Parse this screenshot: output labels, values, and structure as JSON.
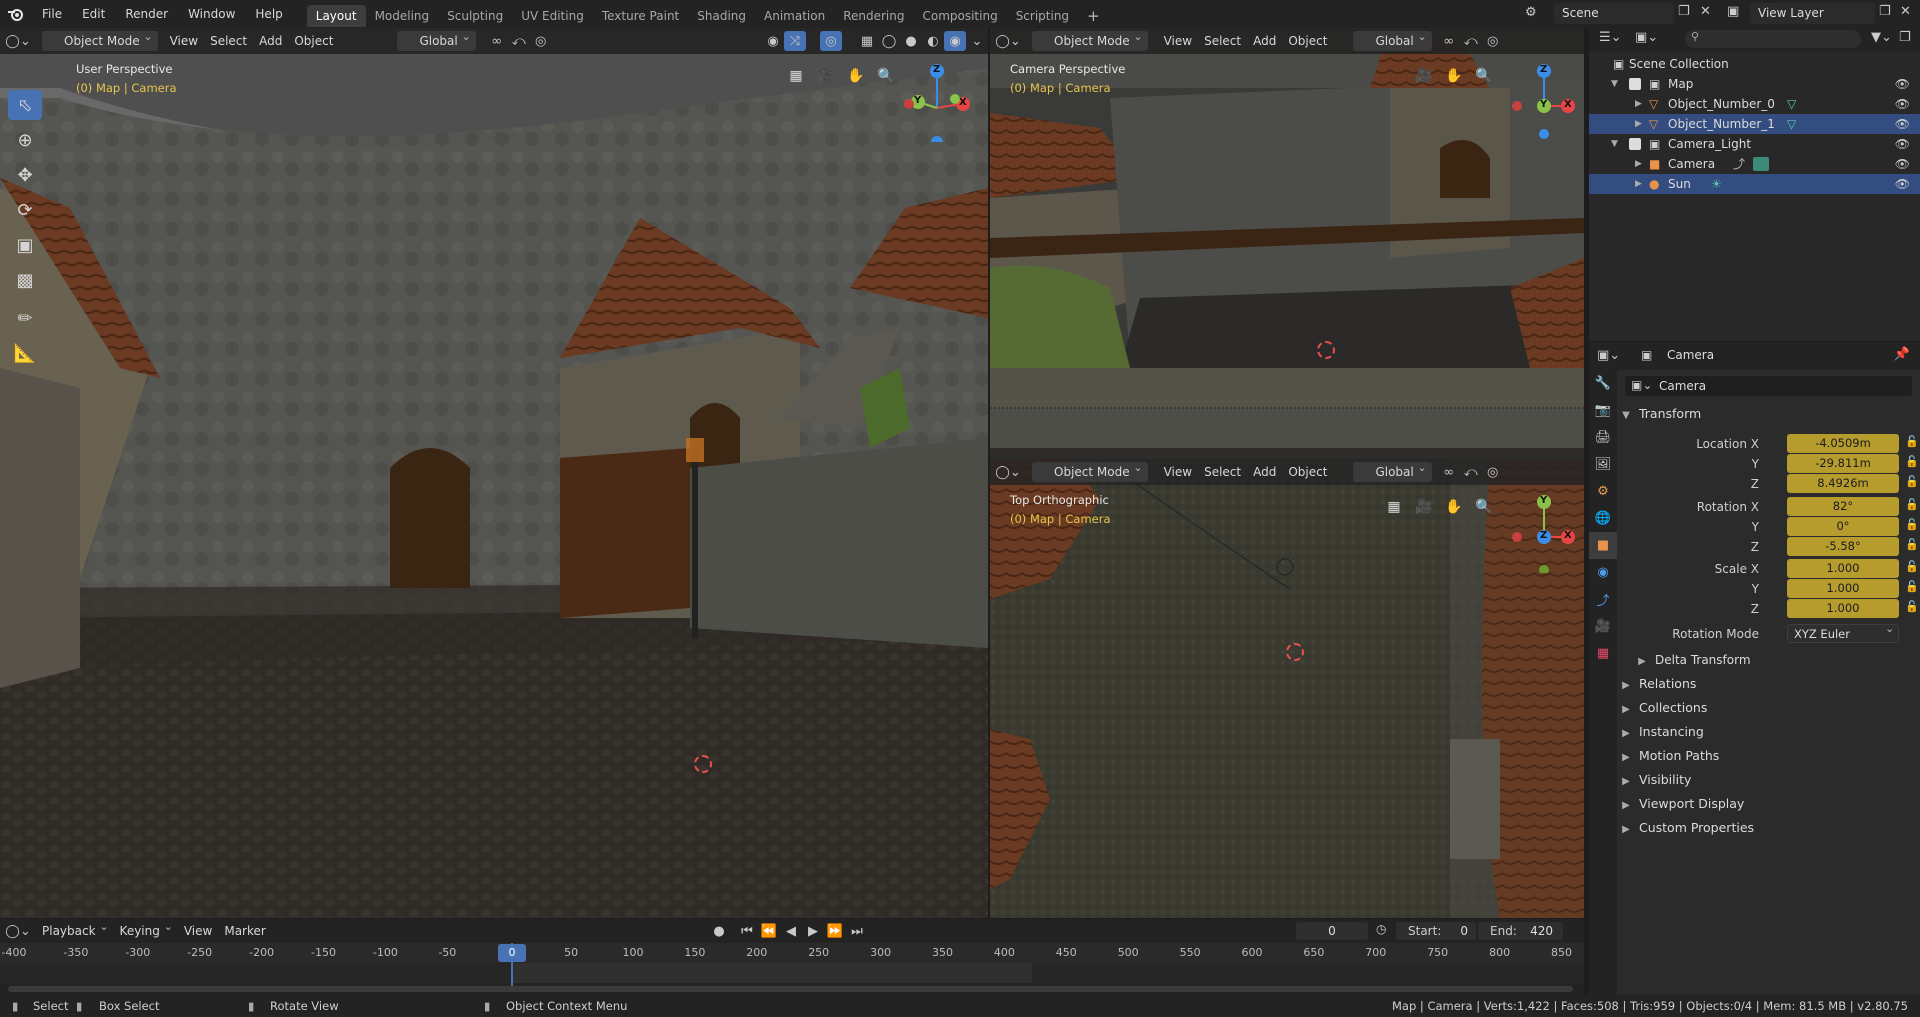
{
  "app": {
    "menus": [
      "File",
      "Edit",
      "Render",
      "Window",
      "Help"
    ],
    "workspaces": [
      "Layout",
      "Modeling",
      "Sculpting",
      "UV Editing",
      "Texture Paint",
      "Shading",
      "Animation",
      "Rendering",
      "Compositing",
      "Scripting"
    ],
    "active_workspace": "Layout",
    "scene": "Scene",
    "view_layer": "View Layer"
  },
  "viewport_header": {
    "mode": "Object Mode",
    "view": "View",
    "select": "Select",
    "add": "Add",
    "object": "Object",
    "orientation": "Global"
  },
  "viewport_main": {
    "label": "User Perspective",
    "sub": "(0) Map | Camera"
  },
  "viewport_camera": {
    "label": "Camera Perspective",
    "sub": "(0) Map | Camera"
  },
  "viewport_top": {
    "label": "Top Orthographic",
    "sub": "(0) Map | Camera"
  },
  "gizmo": {
    "x": "X",
    "y": "Y",
    "z": "Z"
  },
  "outliner": {
    "root": "Scene Collection",
    "items": [
      {
        "name": "Map",
        "kind": "collection"
      },
      {
        "name": "Object_Number_0",
        "kind": "mesh"
      },
      {
        "name": "Object_Number_1",
        "kind": "mesh",
        "selected": true
      },
      {
        "name": "Camera_Light",
        "kind": "collection"
      },
      {
        "name": "Camera",
        "kind": "camera"
      },
      {
        "name": "Sun",
        "kind": "light",
        "selected": true
      }
    ]
  },
  "properties": {
    "header": "Camera",
    "object_name": "Camera",
    "transform_title": "Transform",
    "location": {
      "label_x": "Location X",
      "x": "-4.0509m",
      "label_y": "Y",
      "y": "-29.811m",
      "label_z": "Z",
      "z": "8.4926m"
    },
    "rotation": {
      "label_x": "Rotation X",
      "x": "82°",
      "label_y": "Y",
      "y": "0°",
      "label_z": "Z",
      "z": "-5.58°"
    },
    "scale": {
      "label_x": "Scale X",
      "x": "1.000",
      "label_y": "Y",
      "y": "1.000",
      "label_z": "Z",
      "z": "1.000"
    },
    "rotation_mode_label": "Rotation Mode",
    "rotation_mode": "XYZ Euler",
    "delta_transform": "Delta Transform",
    "sections": [
      "Relations",
      "Collections",
      "Instancing",
      "Motion Paths",
      "Visibility",
      "Viewport Display",
      "Custom Properties"
    ]
  },
  "timeline": {
    "playback": "Playback",
    "keying": "Keying",
    "view": "View",
    "marker": "Marker",
    "current_frame": "0",
    "start_label": "Start:",
    "start": "0",
    "end_label": "End:",
    "end": "420",
    "ruler": [
      "-400",
      "-350",
      "-300",
      "-250",
      "-200",
      "-150",
      "-100",
      "-50",
      "0",
      "50",
      "100",
      "150",
      "200",
      "250",
      "300",
      "350",
      "400",
      "450",
      "500",
      "550",
      "600",
      "650",
      "700",
      "750",
      "800",
      "850"
    ]
  },
  "statusbar": {
    "select": "Select",
    "box_select": "Box Select",
    "rotate_view": "Rotate View",
    "context_menu": "Object Context Menu",
    "stats": "Map | Camera | Verts:1,422 | Faces:508 | Tris:959 | Objects:0/4 | Mem: 81.5 MB | v2.80.75"
  },
  "colors": {
    "accent": "#4772b3",
    "selected_row": "#334d80",
    "field_keyed": "#b59c2d",
    "axis_x": "#e84545",
    "axis_y": "#8bc34a",
    "axis_z": "#3b8ee8",
    "overlay_text": "#e6c64a"
  }
}
